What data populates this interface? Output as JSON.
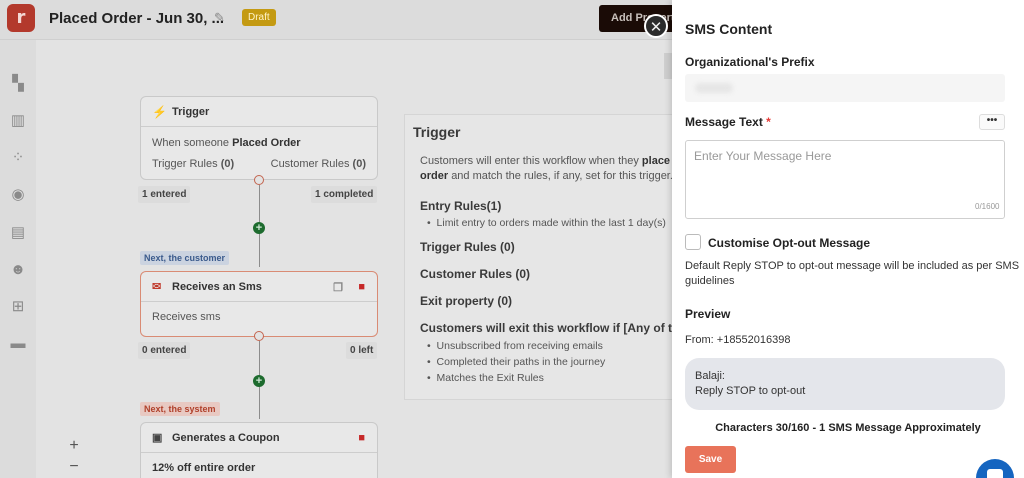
{
  "header": {
    "title": "Placed Order - Jun 30, ...",
    "draft_badge": "Draft",
    "add_button": "Add Property",
    "logo_letter": "r"
  },
  "rail_icons": [
    "dashboard-icon",
    "chart-icon",
    "apps-icon",
    "location-icon",
    "chat-icon",
    "contacts-icon",
    "add-grid-icon",
    "folder-icon"
  ],
  "canvas": {
    "trigger_node": {
      "title": "Trigger",
      "when_prefix": "When someone",
      "when_event": "Placed Order",
      "trigger_rules_label": "Trigger Rules",
      "trigger_rules_count": "(0)",
      "customer_rules_label": "Customer Rules",
      "customer_rules_count": "(0)",
      "entered": "1 entered",
      "completed": "1 completed"
    },
    "tag_customer": "Next, the customer",
    "sms_node": {
      "title": "Receives an Sms",
      "body": "Receives sms",
      "entered": "0 entered",
      "left": "0 left"
    },
    "tag_system": "Next, the system",
    "coupon_node": {
      "title": "Generates a Coupon",
      "body": "12% off entire order"
    },
    "zoom_in": "+",
    "zoom_out": "−"
  },
  "info_panel": {
    "title": "Trigger",
    "intro_line1_a": "Customers will enter this workflow when they",
    "intro_line1_b": "place a s",
    "intro_line2_b": "order",
    "intro_line2_a": "and match the rules, if any, set for this trigger.",
    "entry_rules": "Entry Rules(1)",
    "entry_rule_item": "Limit entry to orders made within the last 1 day(s)",
    "trigger_rules": "Trigger Rules  (0)",
    "customer_rules": "Customer Rules  (0)",
    "exit_property": "Exit property  (0)",
    "exit_heading": "Customers will exit this workflow if [Any of the a",
    "exit_items": [
      "Unsubscribed from receiving emails",
      "Completed their paths in the journey",
      "Matches the Exit Rules"
    ]
  },
  "drawer": {
    "title": "SMS Content",
    "prefix_label": "Organizational's Prefix",
    "message_label": "Message Text",
    "required_mark": "*",
    "more_button": "•••",
    "message_placeholder": "Enter Your Message Here",
    "message_value": "",
    "char_counter": "0/1600",
    "optout_label": "Customise Opt-out Message",
    "optout_help_1": "Default Reply STOP to opt-out message will be included as per SMS",
    "optout_help_2": "guidelines",
    "preview_label": "Preview",
    "preview_from": "From: +18552016398",
    "preview_line1": "Balaji:",
    "preview_line2": "Reply STOP to opt-out",
    "characters_summary": "Characters 30/160 - 1 SMS Message Approximately",
    "save_button": "Save"
  },
  "colors": {
    "accent": "#e8735a",
    "brand": "#c0392b",
    "draft": "#d4a20f",
    "connector_dot": "#1d6b2e",
    "fab": "#1565c0"
  }
}
